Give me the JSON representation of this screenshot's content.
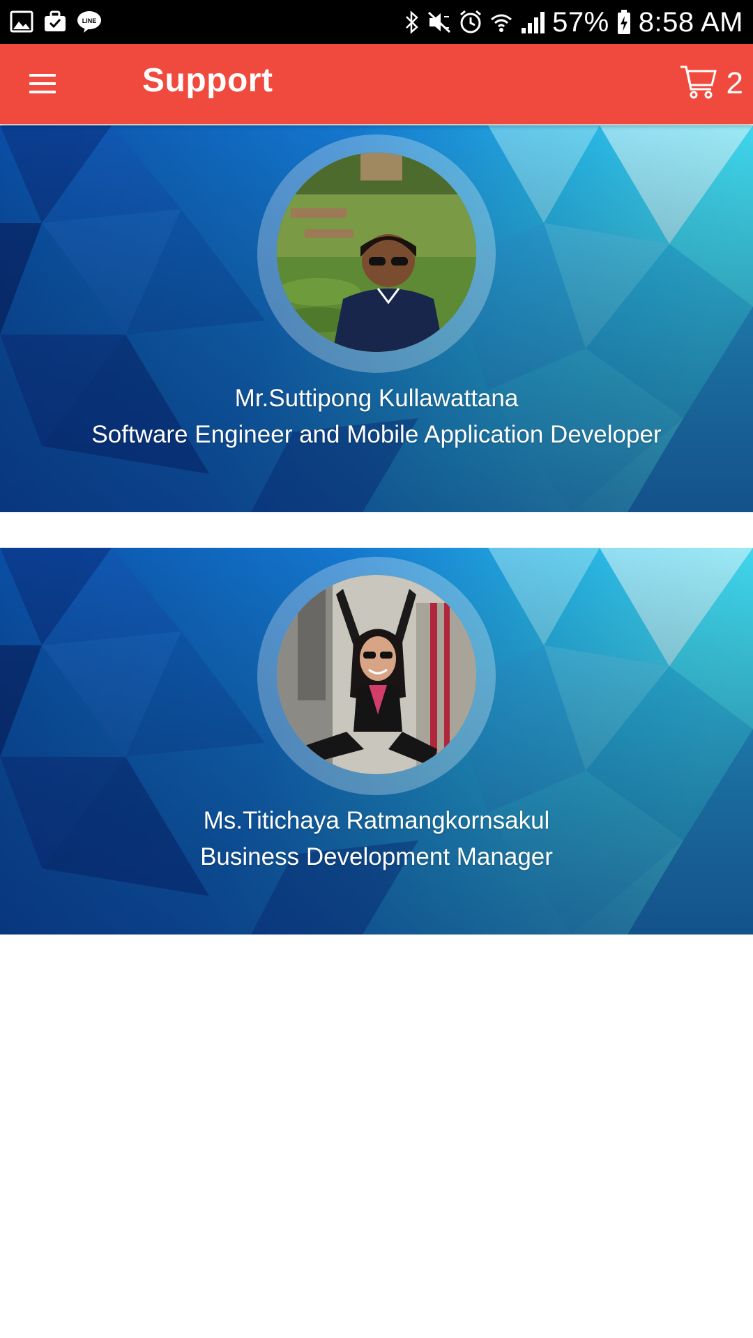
{
  "status_bar": {
    "battery": "57%",
    "time": "8:58 AM",
    "icons": [
      "gallery-icon",
      "briefcase-icon",
      "line-app-icon",
      "bluetooth-icon",
      "mute-icon",
      "alarm-icon",
      "wifi-icon",
      "signal-icon",
      "battery-icon"
    ],
    "line_badge": "LINE"
  },
  "app_bar": {
    "title": "Support",
    "cart_count": "2",
    "color": "#f0493d"
  },
  "contacts": [
    {
      "name": "Mr.Suttipong Kullawattana",
      "role": "Software Engineer and Mobile Application Developer"
    },
    {
      "name": "Ms.Titichaya Ratmangkornsakul",
      "role": "Business Development Manager"
    }
  ],
  "colors": {
    "card_dark_blue": "#0b3a8c",
    "card_light_cyan": "#3fd6ec"
  }
}
